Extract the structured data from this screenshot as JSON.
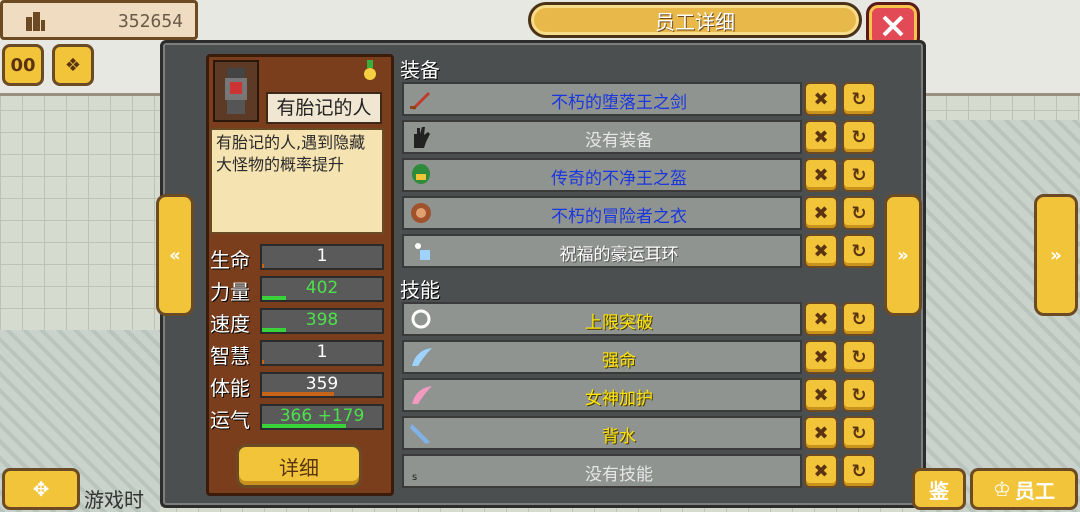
{
  "topbar": {
    "money": "352654",
    "pause_label": "00",
    "coin_label": "❖"
  },
  "header": {
    "title": "员工详细",
    "close_label": "✕"
  },
  "navigation": {
    "prev_label": "«",
    "next_label": "»",
    "outer_next_label": "»"
  },
  "character": {
    "name": "有胎记的人",
    "description": "有胎记的人,遇到隐藏大怪物的概率提升",
    "stats": [
      {
        "label": "生命",
        "value": "1",
        "progress": 0.02,
        "color": "white"
      },
      {
        "label": "力量",
        "value": "402",
        "progress": 0.2,
        "color": "green"
      },
      {
        "label": "速度",
        "value": "398",
        "progress": 0.2,
        "color": "green"
      },
      {
        "label": "智慧",
        "value": "1",
        "progress": 0.02,
        "color": "white"
      },
      {
        "label": "体能",
        "value": "359",
        "progress": 0.6,
        "color": "white"
      },
      {
        "label": "运气",
        "value": "366 +179",
        "progress": 0.7,
        "color": "green"
      }
    ],
    "detail_button": "详细"
  },
  "equipment": {
    "header": "装备",
    "items": [
      {
        "label": "不朽的堕落王之剑",
        "icon": "sword-icon",
        "color": "blue"
      },
      {
        "label": "没有装备",
        "icon": "glove-icon",
        "color": "grey"
      },
      {
        "label": "传奇的不净王之盔",
        "icon": "helmet-icon",
        "color": "blue"
      },
      {
        "label": "不朽的冒险者之衣",
        "icon": "armor-icon",
        "color": "blue"
      },
      {
        "label": "祝福的豪运耳环",
        "icon": "earring-icon",
        "color": "white"
      }
    ]
  },
  "skills": {
    "header": "技能",
    "items": [
      {
        "label": "上限突破",
        "icon": "ring-icon",
        "color": "yellow"
      },
      {
        "label": "强命",
        "icon": "wing-icon",
        "color": "yellow"
      },
      {
        "label": "女神加护",
        "icon": "pink-wing-icon",
        "color": "yellow"
      },
      {
        "label": "背水",
        "icon": "blade-icon",
        "color": "yellow"
      },
      {
        "label": "没有技能",
        "icon": "empty-icon",
        "color": "grey"
      }
    ]
  },
  "row_buttons": {
    "remove": "✖",
    "swap": "↻"
  },
  "bottom": {
    "game_time": "游戏时",
    "dpad_label": "✥",
    "catalog_label": "鉴",
    "staff_label": "员工"
  }
}
